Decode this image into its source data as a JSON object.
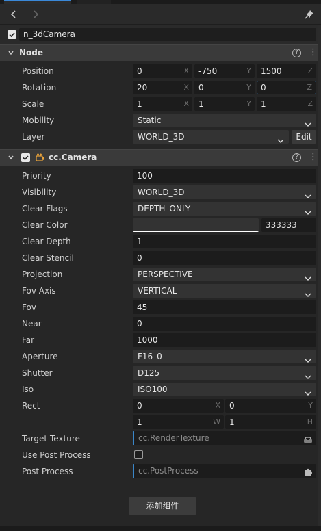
{
  "node_name": "n_3dCamera",
  "node_section": {
    "title": "Node",
    "position": {
      "label": "Position",
      "x": "0",
      "y": "-750",
      "z": "1500"
    },
    "rotation": {
      "label": "Rotation",
      "x": "20",
      "y": "0",
      "z": "0"
    },
    "scale": {
      "label": "Scale",
      "x": "1",
      "y": "1",
      "z": "1"
    },
    "mobility": {
      "label": "Mobility",
      "value": "Static"
    },
    "layer": {
      "label": "Layer",
      "value": "WORLD_3D",
      "edit_label": "Edit"
    },
    "axis_letters": {
      "x": "X",
      "y": "Y",
      "z": "Z",
      "w": "W",
      "h": "H"
    }
  },
  "camera_section": {
    "title": "cc.Camera",
    "priority": {
      "label": "Priority",
      "value": "100"
    },
    "visibility": {
      "label": "Visibility",
      "value": "WORLD_3D"
    },
    "clear_flags": {
      "label": "Clear Flags",
      "value": "DEPTH_ONLY"
    },
    "clear_color": {
      "label": "Clear Color",
      "hex": "333333",
      "swatch_color": "#333333"
    },
    "clear_depth": {
      "label": "Clear Depth",
      "value": "1"
    },
    "clear_stencil": {
      "label": "Clear Stencil",
      "value": "0"
    },
    "projection": {
      "label": "Projection",
      "value": "PERSPECTIVE"
    },
    "fov_axis": {
      "label": "Fov Axis",
      "value": "VERTICAL"
    },
    "fov": {
      "label": "Fov",
      "value": "45"
    },
    "near": {
      "label": "Near",
      "value": "0"
    },
    "far": {
      "label": "Far",
      "value": "1000"
    },
    "aperture": {
      "label": "Aperture",
      "value": "F16_0"
    },
    "shutter": {
      "label": "Shutter",
      "value": "D125"
    },
    "iso": {
      "label": "Iso",
      "value": "ISO100"
    },
    "rect": {
      "label": "Rect",
      "x": "0",
      "y": "0",
      "w": "1",
      "h": "1"
    },
    "target_texture": {
      "label": "Target Texture",
      "placeholder": "cc.RenderTexture"
    },
    "use_post_process": {
      "label": "Use Post Process",
      "checked": false
    },
    "post_process": {
      "label": "Post Process",
      "placeholder": "cc.PostProcess"
    }
  },
  "add_component_label": "添加组件",
  "colors": {
    "accent": "#3a86c8",
    "panel": "#262626",
    "header": "#3a3a3a",
    "input": "#1c1c1c",
    "camera_icon": "#e8a23a"
  }
}
